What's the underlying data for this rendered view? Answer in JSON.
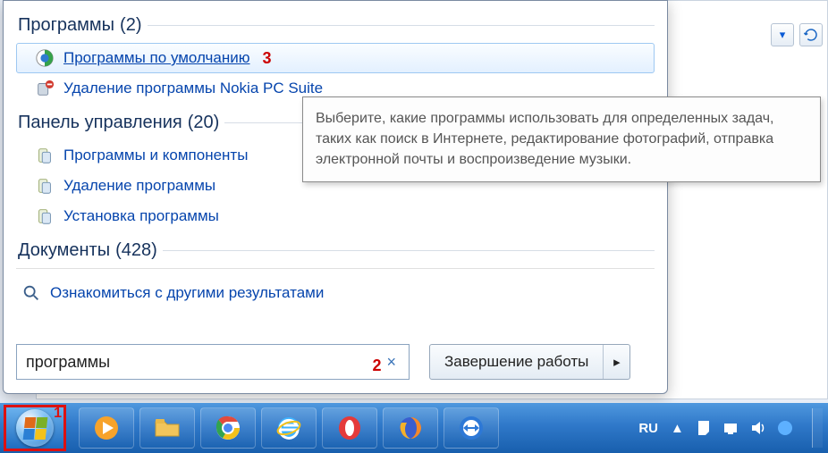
{
  "sections": {
    "programs": {
      "title": "Программы",
      "count": "(2)"
    },
    "controlpanel": {
      "title": "Панель управления",
      "count": "(20)"
    },
    "documents": {
      "title": "Документы",
      "count": "(428)"
    }
  },
  "results": {
    "programs": [
      {
        "label": "Программы по умолчанию",
        "icon": "default-programs-icon",
        "selected": true,
        "annotation": "3"
      },
      {
        "label": "Удаление программы Nokia PC Suite",
        "icon": "uninstall-nokia-icon",
        "selected": false
      }
    ],
    "controlpanel": [
      {
        "label": "Программы и компоненты",
        "icon": "programs-features-icon"
      },
      {
        "label": "Удаление программы",
        "icon": "uninstall-program-icon"
      },
      {
        "label": "Установка программы",
        "icon": "install-program-icon"
      }
    ]
  },
  "see_more": {
    "label": "Ознакомиться с другими результатами"
  },
  "search": {
    "value": "программы",
    "annotation": "2",
    "clear_glyph": "×"
  },
  "shutdown": {
    "label": "Завершение работы",
    "arrow": "▸"
  },
  "tooltip": {
    "text": "Выберите, какие программы использовать для определенных задач, таких как поиск в Интернете, редактирование фотографий, отправка электронной почты и воспроизведение музыки."
  },
  "taskbar": {
    "start_annotation": "1",
    "lang": "RU",
    "tray_up": "▲",
    "items": [
      {
        "name": "media-player-icon"
      },
      {
        "name": "file-explorer-icon"
      },
      {
        "name": "chrome-icon"
      },
      {
        "name": "ie-icon"
      },
      {
        "name": "opera-icon"
      },
      {
        "name": "firefox-icon"
      },
      {
        "name": "teamviewer-icon"
      }
    ]
  },
  "toolbar": {
    "dropdown_glyph": "▾"
  }
}
